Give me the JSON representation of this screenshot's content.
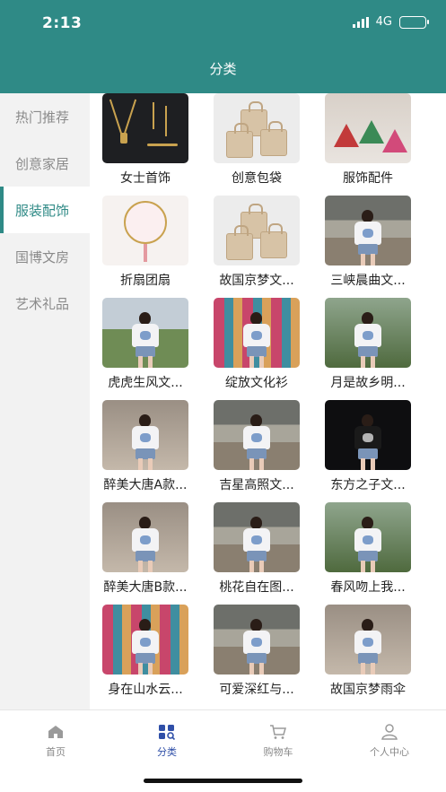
{
  "status": {
    "time": "2:13",
    "network": "4G"
  },
  "header": {
    "title": "分类"
  },
  "sidebar": {
    "items": [
      {
        "label": "热门推荐"
      },
      {
        "label": "创意家居"
      },
      {
        "label": "服装配饰",
        "active": true
      },
      {
        "label": "国博文房"
      },
      {
        "label": "艺术礼品"
      }
    ]
  },
  "products": [
    {
      "label": "女士首饰",
      "thumb": "jewelry"
    },
    {
      "label": "创意包袋",
      "thumb": "bags"
    },
    {
      "label": "服饰配件",
      "thumb": "pouches"
    },
    {
      "label": "折扇团扇",
      "thumb": "fan"
    },
    {
      "label": "故国京梦文...",
      "thumb": "bags"
    },
    {
      "label": "三峡晨曲文...",
      "thumb": "tee-street"
    },
    {
      "label": "虎虎生风文...",
      "thumb": "tee-city"
    },
    {
      "label": "绽放文化衫",
      "thumb": "tee-flowers"
    },
    {
      "label": "月是故乡明...",
      "thumb": "tee-green"
    },
    {
      "label": "醉美大唐A款...",
      "thumb": "tee-wall"
    },
    {
      "label": "吉星高照文...",
      "thumb": "tee-street"
    },
    {
      "label": "东方之子文...",
      "thumb": "tee-black"
    },
    {
      "label": "醉美大唐B款...",
      "thumb": "tee-wall"
    },
    {
      "label": "桃花自在图...",
      "thumb": "tee-street"
    },
    {
      "label": "春风吻上我...",
      "thumb": "tee-green"
    },
    {
      "label": "身在山水云...",
      "thumb": "tee-flowers"
    },
    {
      "label": "可爱深红与...",
      "thumb": "tee-street"
    },
    {
      "label": "故国京梦雨伞",
      "thumb": "tee-wall"
    }
  ],
  "tabbar": {
    "items": [
      {
        "label": "首页",
        "icon": "home-icon"
      },
      {
        "label": "分类",
        "icon": "category-icon",
        "active": true
      },
      {
        "label": "购物车",
        "icon": "cart-icon"
      },
      {
        "label": "个人中心",
        "icon": "user-icon"
      }
    ]
  },
  "colors": {
    "primary": "#2f8a86",
    "tab_active": "#2f4fa8",
    "sidebar_bg": "#f2f2f2"
  }
}
